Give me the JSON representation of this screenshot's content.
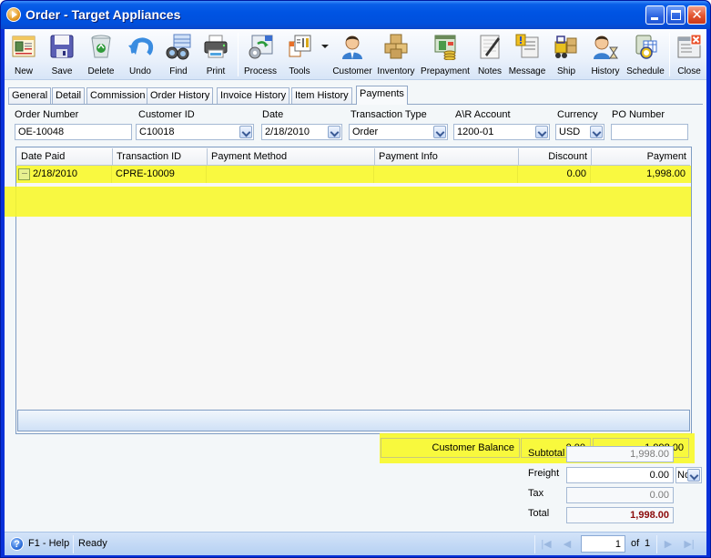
{
  "window": {
    "title": "Order - Target Appliances",
    "controls": {
      "minimize": "minimize",
      "maximize": "maximize",
      "close": "✕"
    }
  },
  "toolbar": {
    "buttons": [
      {
        "label": "New",
        "icon": "new-document-icon"
      },
      {
        "label": "Save",
        "icon": "floppy-disk-icon"
      },
      {
        "label": "Delete",
        "icon": "recycle-bin-icon"
      },
      {
        "label": "Undo",
        "icon": "undo-arrow-icon"
      },
      {
        "label": "Find",
        "icon": "binoculars-icon"
      },
      {
        "label": "Print",
        "icon": "printer-icon"
      },
      {
        "label": "Process",
        "icon": "process-gear-icon"
      },
      {
        "label": "Tools",
        "icon": "tools-icon"
      },
      {
        "label": "Customer",
        "icon": "customer-person-icon"
      },
      {
        "label": "Inventory",
        "icon": "boxes-icon"
      },
      {
        "label": "Prepayment",
        "icon": "prepayment-coins-icon"
      },
      {
        "label": "Notes",
        "icon": "notepad-pen-icon"
      },
      {
        "label": "Message",
        "icon": "message-icon"
      },
      {
        "label": "Ship",
        "icon": "forklift-icon"
      },
      {
        "label": "History",
        "icon": "history-hourglass-icon"
      },
      {
        "label": "Schedule",
        "icon": "schedule-calendar-icon"
      },
      {
        "label": "Close",
        "icon": "close-window-icon"
      }
    ]
  },
  "tabs": [
    {
      "label": "General",
      "active": false
    },
    {
      "label": "Detail",
      "active": false
    },
    {
      "label": "Commission",
      "active": false
    },
    {
      "label": "Order History",
      "active": false
    },
    {
      "label": "Invoice History",
      "active": false
    },
    {
      "label": "Item History",
      "active": false
    },
    {
      "label": "Payments",
      "active": true
    }
  ],
  "header_fields": {
    "order_number": {
      "label": "Order Number",
      "value": "OE-10048"
    },
    "customer_id": {
      "label": "Customer ID",
      "value": "C10018"
    },
    "date": {
      "label": "Date",
      "value": "2/18/2010"
    },
    "transaction_type": {
      "label": "Transaction Type",
      "value": "Order"
    },
    "ar_account": {
      "label": "A\\R Account",
      "value": "1200-01"
    },
    "currency": {
      "label": "Currency",
      "value": "USD"
    },
    "po_number": {
      "label": "PO Number",
      "value": ""
    }
  },
  "payments_grid": {
    "columns": [
      "Date Paid",
      "Transaction ID",
      "Payment Method",
      "Payment Info",
      "Discount",
      "Payment"
    ],
    "rows": [
      {
        "date_paid": "2/18/2010",
        "transaction_id": "CPRE-10009",
        "payment_method": "",
        "payment_info": "",
        "discount": "0.00",
        "payment": "1,998.00",
        "ellipsis": "···"
      }
    ],
    "summary": {
      "label": "Customer Balance",
      "discount": "0.00",
      "payment": "1,998.00"
    }
  },
  "totals": {
    "subtotal": {
      "label": "Subtotal",
      "value": "1,998.00"
    },
    "freight": {
      "label": "Freight",
      "value": "0.00",
      "option": "No"
    },
    "tax": {
      "label": "Tax",
      "value": "0.00"
    },
    "total": {
      "label": "Total",
      "value": "1,998.00"
    }
  },
  "statusbar": {
    "help": "F1 - Help",
    "help_icon": "?",
    "status": "Ready",
    "pager": {
      "page": "1",
      "of_label": "of",
      "total": "1",
      "first": "|◀",
      "prev": "◀",
      "next": "▶",
      "last": "▶|"
    }
  }
}
